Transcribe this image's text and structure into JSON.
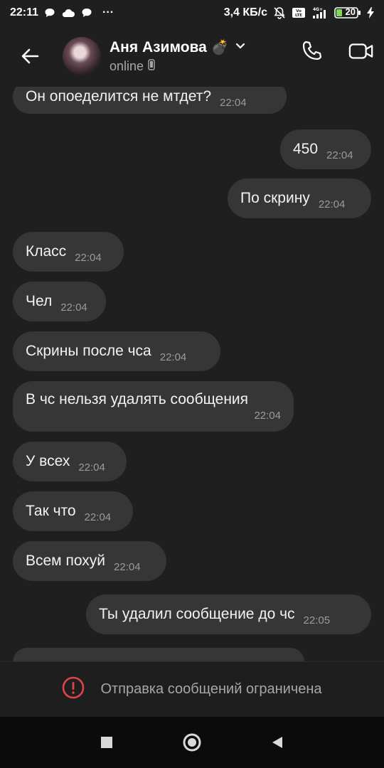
{
  "status_bar": {
    "time": "22:11",
    "dots": "···",
    "speed": "3,4 КБ/с",
    "battery": "20"
  },
  "header": {
    "contact_name": "Аня Азимова",
    "contact_emoji": "💣",
    "status": "online"
  },
  "messages": [
    {
      "side": "in",
      "text": "Он опоеделится не мтдет?",
      "time": "22:04"
    },
    {
      "side": "out",
      "text": "450",
      "time": "22:04"
    },
    {
      "side": "out",
      "text": "По скрину",
      "time": "22:04"
    },
    {
      "side": "in",
      "text": "Класс",
      "time": "22:04"
    },
    {
      "side": "in",
      "text": "Чел",
      "time": "22:04"
    },
    {
      "side": "in",
      "text": "Скрины после чса",
      "time": "22:04"
    },
    {
      "side": "in",
      "text": "В чс нельзя удалять сообщения",
      "time": "22:04"
    },
    {
      "side": "in",
      "text": "У всех",
      "time": "22:04"
    },
    {
      "side": "in",
      "text": "Так что",
      "time": "22:04"
    },
    {
      "side": "in",
      "text": "Всем похуй",
      "time": "22:04"
    },
    {
      "side": "out",
      "text": "Ты удалил сообщение до чс",
      "time": "22:05"
    }
  ],
  "footer": {
    "restricted_text": "Отправка сообщений ограничена"
  },
  "colors": {
    "background": "#1f1f1f",
    "bubble": "#363636",
    "warning": "#e0444a"
  }
}
